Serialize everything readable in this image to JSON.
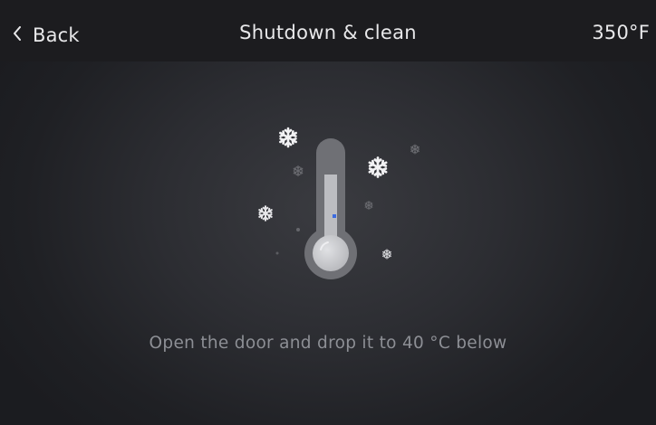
{
  "header": {
    "back_label": "Back",
    "title": "Shutdown & clean",
    "temperature": "350°F"
  },
  "main": {
    "illustration_icon": "thermometer-with-snowflakes-icon",
    "message": "Open the door and drop it to 40 °C below"
  },
  "colors": {
    "header_bg": "#1c1c1f",
    "screen_bg": "#2c2d32",
    "accent": "#3d6bdf",
    "text_primary": "#e8e8ea",
    "text_muted": "#8d8f95"
  }
}
